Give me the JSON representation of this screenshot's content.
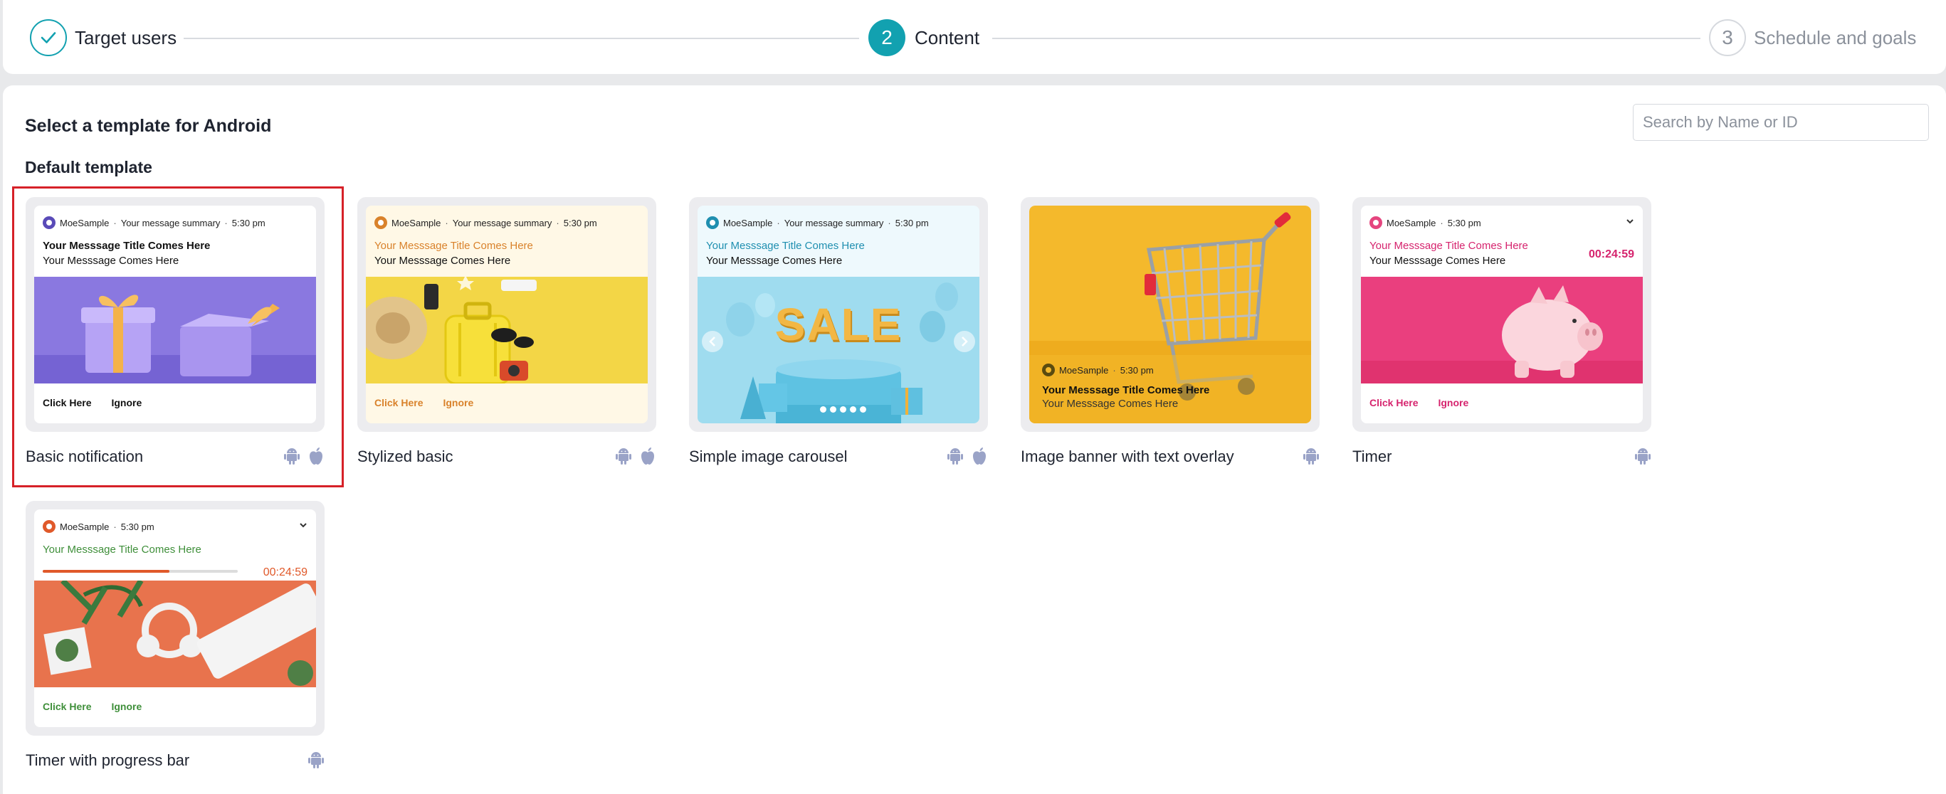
{
  "stepper": {
    "steps": [
      {
        "number": "1",
        "label": "Target users",
        "state": "done"
      },
      {
        "number": "2",
        "label": "Content",
        "state": "active"
      },
      {
        "number": "3",
        "label": "Schedule and goals",
        "state": "pending"
      }
    ]
  },
  "page": {
    "title": "Select a template for Android",
    "section_title": "Default template",
    "search_placeholder": "Search by Name or ID"
  },
  "colors": {
    "accent": "#12a1b0",
    "selection_outline": "#d62128",
    "os_icon": "#9aa3c7"
  },
  "templates": [
    {
      "name": "Basic notification",
      "selected": true,
      "platforms": [
        "android-icon",
        "apple-icon"
      ],
      "app_name": "MoeSample",
      "summary": "Your message summary",
      "time": "5:30 pm",
      "title": "Your Messsage Title Comes Here",
      "body": "Your Messsage Comes Here",
      "action_primary": "Click Here",
      "action_secondary": "Ignore",
      "title_color": "#111111",
      "action_color": "#111111",
      "bg_color": "#ffffff",
      "image": "purple-gift-boxes-image"
    },
    {
      "name": "Stylized basic",
      "selected": false,
      "platforms": [
        "android-icon",
        "apple-icon"
      ],
      "app_name": "MoeSample",
      "summary": "Your message summary",
      "time": "5:30 pm",
      "title": "Your Messsage Title Comes Here",
      "body": "Your Messsage Comes Here",
      "action_primary": "Click Here",
      "action_secondary": "Ignore",
      "title_color": "#d9822b",
      "action_color": "#d9822b",
      "bg_color": "#fff8e6",
      "image": "yellow-travel-suitcase-image"
    },
    {
      "name": "Simple image carousel",
      "selected": false,
      "platforms": [
        "android-icon",
        "apple-icon"
      ],
      "app_name": "MoeSample",
      "summary": "Your message summary",
      "time": "5:30 pm",
      "title": "Your Messsage Title Comes Here",
      "body": "Your Messsage Comes Here",
      "sale_text": "SALE",
      "title_color": "#1f8fb0",
      "bg_color": "#eef9fd",
      "image": "sale-balloons-carousel-image"
    },
    {
      "name": "Image banner with text overlay",
      "selected": false,
      "platforms": [
        "android-icon"
      ],
      "app_name": "MoeSample",
      "time": "5:30 pm",
      "title": "Your Messsage Title Comes Here",
      "body": "Your Messsage Comes Here",
      "image": "shopping-cart-banner-image"
    },
    {
      "name": "Timer",
      "selected": false,
      "platforms": [
        "android-icon"
      ],
      "app_name": "MoeSample",
      "time": "5:30 pm",
      "title": "Your Messsage Title Comes Here",
      "body": "Your Messsage Comes Here",
      "timer": "00:24:59",
      "action_primary": "Click Here",
      "action_secondary": "Ignore",
      "title_color": "#d6246e",
      "action_color": "#d6246e",
      "image": "piggy-bank-image"
    },
    {
      "name": "Timer with progress bar",
      "selected": false,
      "platforms": [
        "android-icon"
      ],
      "app_name": "MoeSample",
      "time": "5:30 pm",
      "title": "Your Messsage Title Comes Here",
      "timer": "00:24:59",
      "progress": 0.65,
      "action_primary": "Click Here",
      "action_secondary": "Ignore",
      "title_color": "#3f8f3a",
      "action_color": "#3f8f3a",
      "timer_color": "#e0592a",
      "image": "headphones-keyboard-desk-image"
    }
  ]
}
